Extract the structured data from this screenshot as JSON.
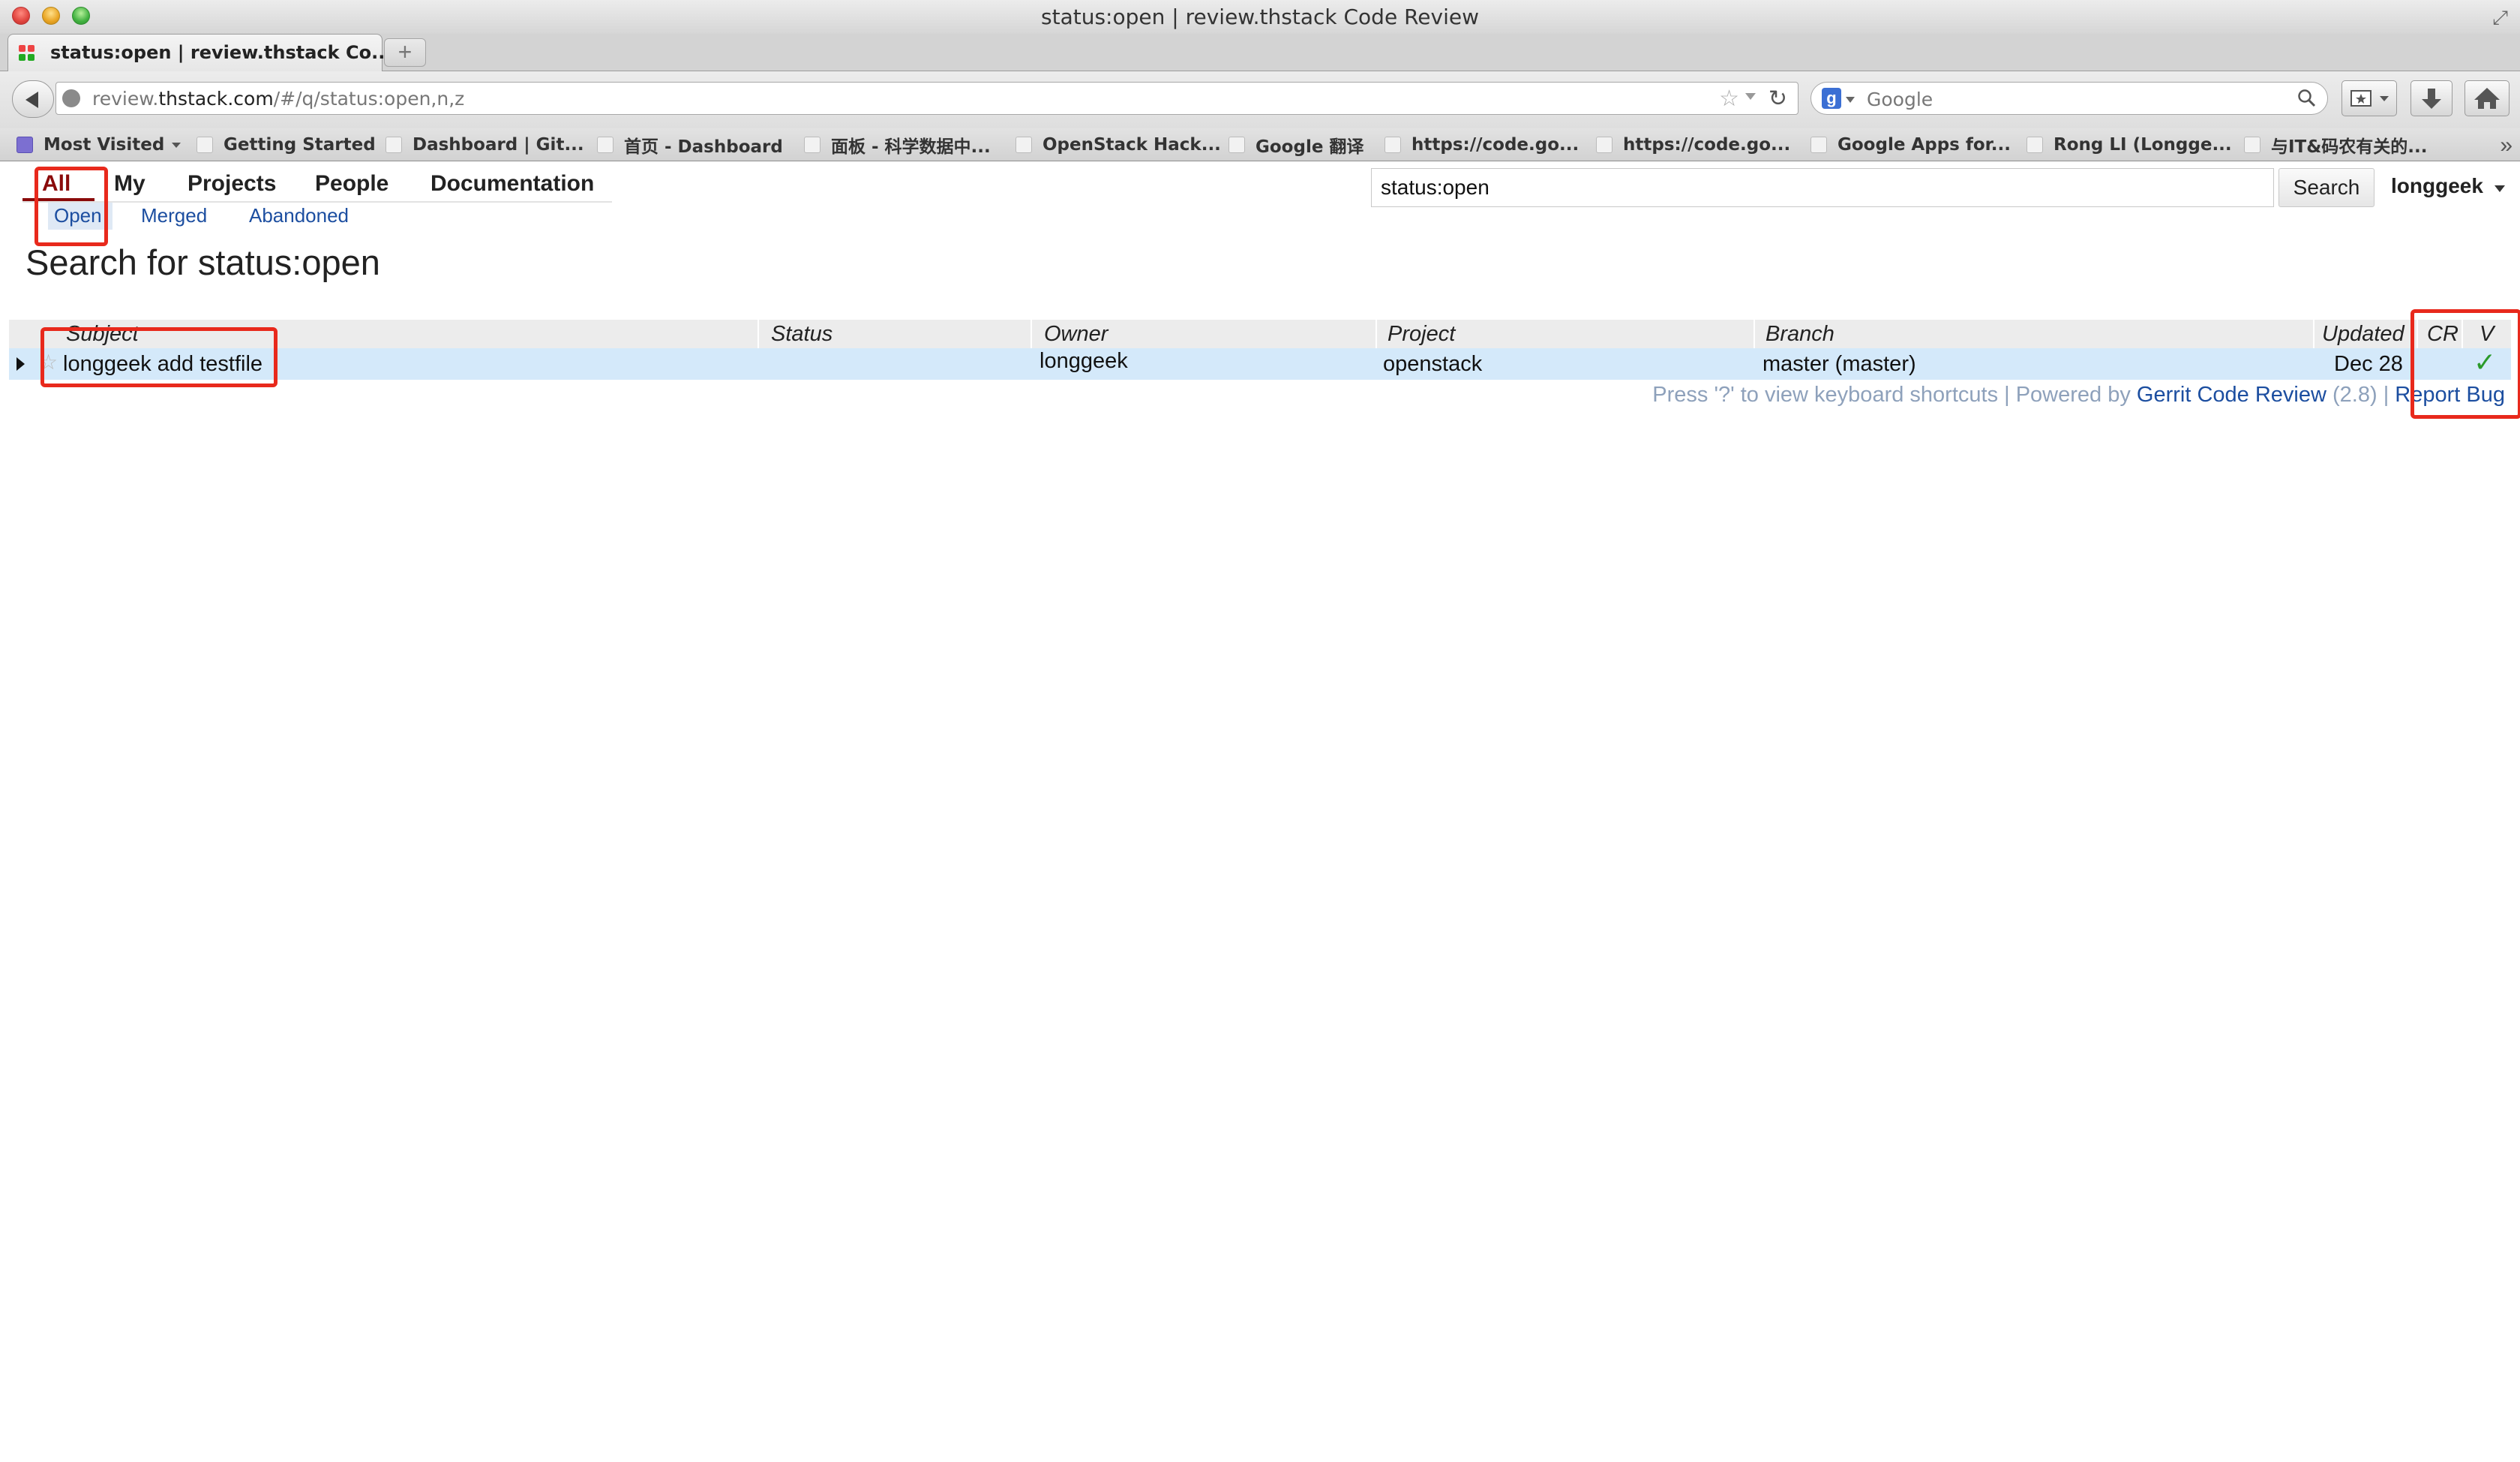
{
  "window": {
    "title": "status:open | review.thstack Code Review"
  },
  "tab": {
    "title": "status:open | review.thstack Co...",
    "new_tab_label": "+"
  },
  "address": {
    "prefix": "review.",
    "domain": "thstack.com",
    "path": "/#/q/status:open,n,z"
  },
  "search_box": {
    "placeholder": "Google",
    "engine_icon": "g"
  },
  "bookmarks": [
    {
      "label": "Most Visited"
    },
    {
      "label": "Getting Started"
    },
    {
      "label": "Dashboard | Git..."
    },
    {
      "label": "首页 - Dashboard"
    },
    {
      "label": "面板 - 科学数据中..."
    },
    {
      "label": "OpenStack Hack..."
    },
    {
      "label": "Google 翻译"
    },
    {
      "label": "https://code.go..."
    },
    {
      "label": "https://code.go..."
    },
    {
      "label": "Google Apps for..."
    },
    {
      "label": "Rong LI (Longge..."
    },
    {
      "label": "与IT&码农有关的..."
    }
  ],
  "menu": {
    "top": [
      "All",
      "My",
      "Projects",
      "People",
      "Documentation"
    ],
    "sub": [
      "Open",
      "Merged",
      "Abandoned"
    ]
  },
  "search": {
    "query": "status:open",
    "button": "Search"
  },
  "user": {
    "name": "longgeek"
  },
  "page_title": "Search for status:open",
  "table": {
    "headers": [
      "Subject",
      "Status",
      "Owner",
      "Project",
      "Branch",
      "Updated",
      "CR",
      "V"
    ],
    "rows": [
      {
        "subject": "longgeek add testfile",
        "status": "",
        "owner": "longgeek",
        "project": "openstack",
        "branch": "master (master)",
        "updated": "Dec 28",
        "cr": "",
        "v": "✓"
      }
    ]
  },
  "footer": {
    "text": "Press '?' to view keyboard shortcuts | Powered by ",
    "link": "Gerrit Code Review",
    "version": " (2.8) | ",
    "report": "Report Bug"
  },
  "colors": {
    "annotation": "#e8291c",
    "link": "#1c4ea0",
    "row_highlight": "#d4e9fa",
    "check": "#2a9a2a"
  }
}
